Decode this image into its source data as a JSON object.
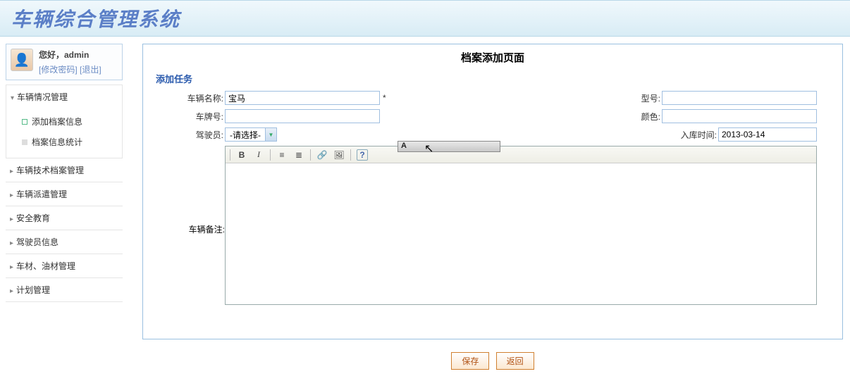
{
  "banner": {
    "title": "车辆综合管理系统"
  },
  "user": {
    "greeting": "您好，admin",
    "change_pwd": "[修改密码]",
    "logout": "[退出]"
  },
  "nav": {
    "item0": {
      "label": "车辆情况管理"
    },
    "sub0": {
      "label": "添加档案信息"
    },
    "sub1": {
      "label": "档案信息统计"
    },
    "item1": {
      "label": "车辆技术档案管理"
    },
    "item2": {
      "label": "车辆派遣管理"
    },
    "item3": {
      "label": "安全教育"
    },
    "item4": {
      "label": "驾驶员信息"
    },
    "item5": {
      "label": "车材、油材管理"
    },
    "item6": {
      "label": "计划管理"
    }
  },
  "page": {
    "title": "档案添加页面",
    "legend": "添加任务"
  },
  "form": {
    "vehicle_name_label": "车辆名称:",
    "vehicle_name_value": "宝马",
    "req": "*",
    "model_label": "型号:",
    "model_value": "",
    "plate_label": "车牌号:",
    "plate_value": "",
    "color_label": "颜色:",
    "color_value": "",
    "driver_label": "驾驶员:",
    "driver_selected": "-请选择-",
    "entry_time_label": "入库时间:",
    "entry_time_value": "2013-03-14",
    "remark_label": "车辆备注:"
  },
  "editor_toolbar": {
    "bold": "B",
    "italic": "I",
    "olist": "≡",
    "ulist": "≣",
    "link": "🔗",
    "image": "🖼",
    "help": "?"
  },
  "buttons": {
    "save": "保存",
    "back": "返回"
  },
  "ime": {
    "candidate": "A"
  }
}
